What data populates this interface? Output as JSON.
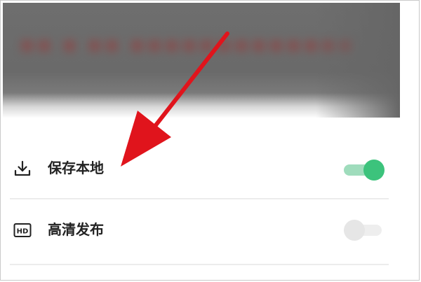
{
  "settings": {
    "items": [
      {
        "label": "保存本地",
        "icon": "download-icon",
        "enabled": true
      },
      {
        "label": "高清发布",
        "icon": "hd-icon",
        "enabled": false
      }
    ]
  },
  "colors": {
    "toggle_on": "#3cc37c",
    "toggle_off": "#e6e6e6",
    "annotation_arrow": "#e0141c"
  }
}
